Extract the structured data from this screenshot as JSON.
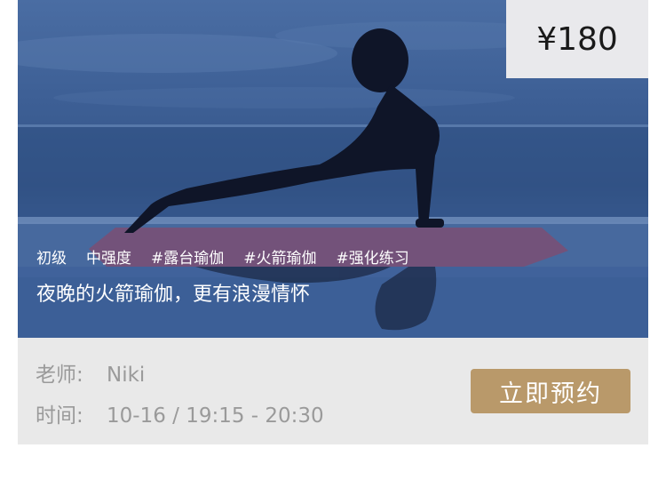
{
  "course": {
    "price": "¥180",
    "tags": [
      "初级",
      "中强度",
      "#露台瑜伽",
      "#火箭瑜伽",
      "#强化练习"
    ],
    "subtitle": "夜晚的火箭瑜伽，更有浪漫情怀"
  },
  "details": {
    "teacher_label": "老师:",
    "teacher_value": "Niki",
    "time_label": "时间:",
    "time_value": "10-16 / 19:15 - 20:30"
  },
  "actions": {
    "book_label": "立即预约"
  },
  "colors": {
    "book_button": "#b9996a",
    "info_panel": "#e9e9e9",
    "price_box": "#e9e9ec"
  }
}
